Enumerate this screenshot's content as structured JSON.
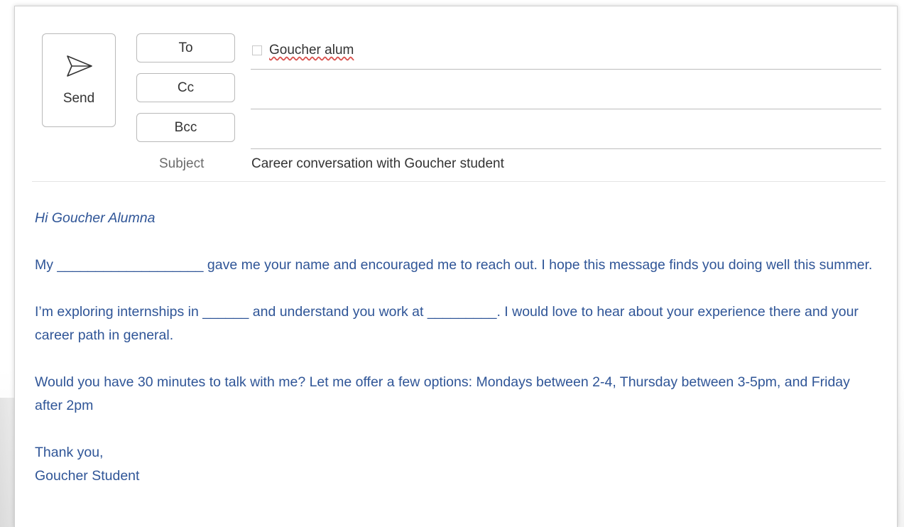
{
  "compose": {
    "send_label": "Send",
    "to_label": "To",
    "cc_label": "Cc",
    "bcc_label": "Bcc",
    "to_recipient": "Goucher alum",
    "cc_value": "",
    "bcc_value": "",
    "subject_label": "Subject",
    "subject_value": "Career conversation with Goucher student"
  },
  "body": {
    "greeting": "Hi Goucher Alumna",
    "paragraph_1": "My ___________________ gave me your name and encouraged me to reach out.  I hope this message finds you doing well this summer.",
    "paragraph_2": "I’m exploring internships in ______ and understand you work at _________.   I would love to hear about your experience there and your career path in general.",
    "paragraph_3": "Would you have 30 minutes to talk with me?  Let me offer a few options:  Mondays between 2-4, Thursday between 3-5pm, and Friday after 2pm",
    "signoff_line_1": "Thank you,",
    "signoff_line_2": "Goucher Student"
  },
  "colors": {
    "body_text": "#2f5597",
    "header_text": "#333333",
    "subject_label": "#6b6b6b"
  },
  "icons": {
    "send": "send-paper-plane-icon",
    "recipient_checkbox": "checkbox-icon"
  }
}
